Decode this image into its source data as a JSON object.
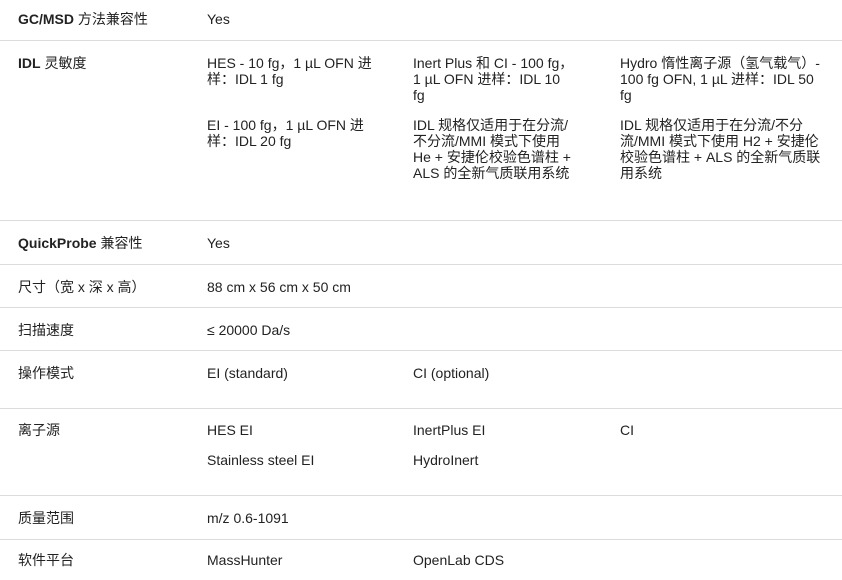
{
  "specs": {
    "gc_msd": {
      "label_bold": "GC/MSD",
      "label_rest": " 方法兼容性",
      "value": "Yes"
    },
    "idl": {
      "label_bold": "IDL",
      "label_rest": " 灵敏度",
      "c1a": "HES - 10 fg，1 µL OFN 进样：IDL 1 fg",
      "c2a": "Inert Plus 和 CI - 100 fg，1 µL OFN 进样：IDL 10 fg",
      "c3a": "Hydro 惰性离子源（氢气载气）- 100 fg OFN, 1 µL 进样：IDL 50 fg",
      "c1b": "EI - 100 fg，1 µL OFN 进样：IDL 20 fg",
      "c2b": "IDL 规格仅适用于在分流/不分流/MMI 模式下使用 He + 安捷伦校验色谱柱 + ALS 的全新气质联用系统",
      "c3b": "IDL 规格仅适用于在分流/不分流/MMI 模式下使用 H2 + 安捷伦校验色谱柱 + ALS 的全新气质联用系统"
    },
    "quickprobe": {
      "label_bold": "QuickProbe",
      "label_rest": " 兼容性",
      "value": "Yes"
    },
    "dimensions": {
      "label": "尺寸（宽 x 深 x 高）",
      "value": "88 cm x 56 cm x 50 cm"
    },
    "scan_speed": {
      "label": "扫描速度",
      "value": "≤ 20000 Da/s"
    },
    "mode": {
      "label": "操作模式",
      "v1": "EI (standard)",
      "v2": "CI (optional)"
    },
    "source": {
      "label": "离子源",
      "v1a": "HES EI",
      "v2a": "InertPlus EI",
      "v3a": "CI",
      "v1b": "Stainless steel EI",
      "v2b": "HydroInert"
    },
    "mass_range": {
      "label": "质量范围",
      "value": "m/z 0.6-1091"
    },
    "software": {
      "label": "软件平台",
      "v1": "MassHunter",
      "v2": "OpenLab CDS"
    }
  }
}
